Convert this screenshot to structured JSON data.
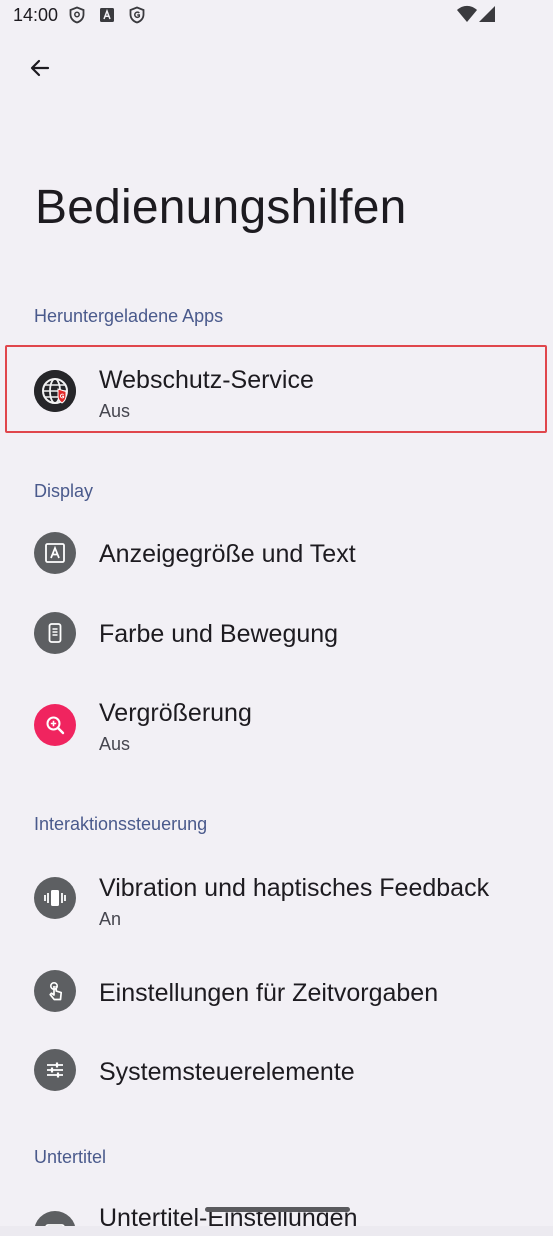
{
  "status_bar": {
    "time": "14:00",
    "left_icons": [
      "shield-icon",
      "font-a-icon",
      "g-data-shield-icon"
    ],
    "right_icons": [
      "wifi-icon",
      "cell-signal-icon"
    ]
  },
  "header": {
    "back_icon": "arrow-back-icon",
    "title": "Bedienungshilfen"
  },
  "sections": [
    {
      "label": "Heruntergeladene Apps",
      "items": [
        {
          "title": "Webschutz-Service",
          "subtitle": "Aus",
          "icon": "webschutz-globe-icon",
          "highlighted": true
        }
      ]
    },
    {
      "label": "Display",
      "items": [
        {
          "title": "Anzeigegröße und Text",
          "icon": "text-size-icon"
        },
        {
          "title": "Farbe und Bewegung",
          "icon": "color-motion-icon"
        },
        {
          "title": "Vergrößerung",
          "subtitle": "Aus",
          "icon": "magnification-icon"
        }
      ]
    },
    {
      "label": "Interaktionssteuerung",
      "items": [
        {
          "title": "Vibration und haptisches Feedback",
          "subtitle": "An",
          "icon": "vibration-icon"
        },
        {
          "title": "Einstellungen für Zeitvorgaben",
          "icon": "touch-timing-icon"
        },
        {
          "title": "Systemsteuerelemente",
          "icon": "system-controls-icon"
        }
      ]
    },
    {
      "label": "Untertitel",
      "items": [
        {
          "title": "Untertitel-Einstellungen",
          "icon": "captions-icon"
        }
      ]
    }
  ],
  "colors": {
    "background": "#f2f0f5",
    "section_header": "#4a5a8c",
    "icon_circle": "#5d5f62",
    "magnification_accent": "#f0245f",
    "highlight_border": "#e0464c"
  }
}
